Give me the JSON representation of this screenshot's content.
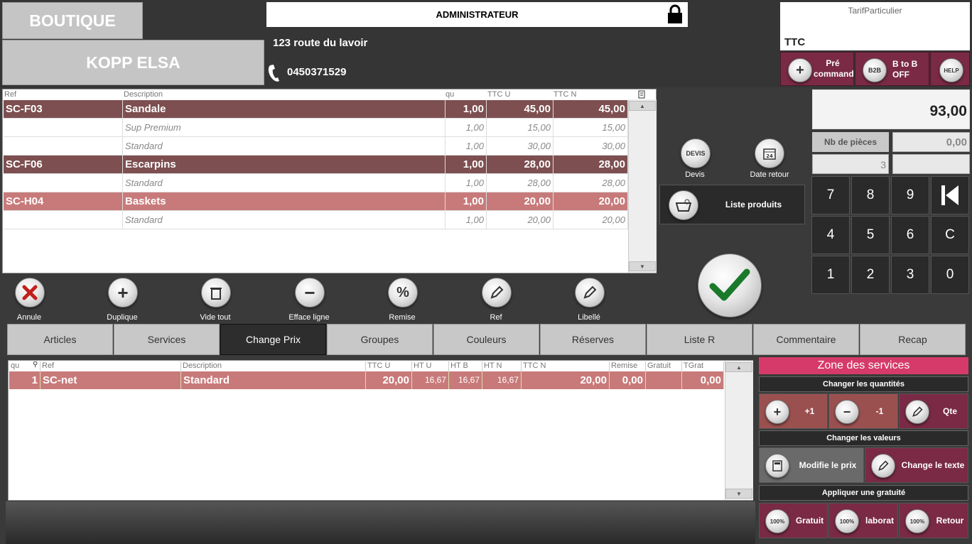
{
  "header": {
    "boutique_label": "BOUTIQUE",
    "client_name": "KOPP ELSA",
    "user_label": "ADMINISTRATEUR",
    "address": "123 route du lavoir",
    "phone": "0450371529",
    "tarif_label": "TarifParticulier",
    "tax_mode": "TTC",
    "precommande_label": "Pré commande",
    "btob_badge": "B2B",
    "btob_label": "B to B OFF",
    "help_badge": "HELP"
  },
  "cart": {
    "columns": [
      "Ref",
      "Description",
      "qu",
      "TTC U",
      "TTC N"
    ],
    "rows": [
      {
        "kind": "main",
        "ref": "SC-F03",
        "desc": "Sandale",
        "qty": "1,00",
        "ttcu": "45,00",
        "ttcn": "45,00",
        "color": "#7d4f50"
      },
      {
        "kind": "sub",
        "ref": "",
        "desc": "Sup Premium",
        "qty": "1,00",
        "ttcu": "15,00",
        "ttcn": "15,00"
      },
      {
        "kind": "sub",
        "ref": "",
        "desc": "Standard",
        "qty": "1,00",
        "ttcu": "30,00",
        "ttcn": "30,00"
      },
      {
        "kind": "main",
        "ref": "SC-F06",
        "desc": "Escarpins",
        "qty": "1,00",
        "ttcu": "28,00",
        "ttcn": "28,00",
        "color": "#7d4f50"
      },
      {
        "kind": "sub",
        "ref": "",
        "desc": "Standard",
        "qty": "1,00",
        "ttcu": "28,00",
        "ttcn": "28,00"
      },
      {
        "kind": "main",
        "ref": "SC-H04",
        "desc": "Baskets",
        "qty": "1,00",
        "ttcu": "20,00",
        "ttcn": "20,00",
        "color": "#c87a7a"
      },
      {
        "kind": "sub",
        "ref": "",
        "desc": "Standard",
        "qty": "1,00",
        "ttcu": "20,00",
        "ttcn": "20,00"
      }
    ]
  },
  "toolbar": {
    "annule": "Annule",
    "duplique": "Duplique",
    "vide_tout": "Vide tout",
    "efface_ligne": "Efface ligne",
    "remise": "Remise",
    "ref": "Ref",
    "libelle": "Libellé"
  },
  "actions": {
    "devis_badge": "DEVIS",
    "devis": "Devis",
    "date_retour": "Date retour",
    "calendar_day": "24",
    "liste_produits": "Liste produits"
  },
  "totals": {
    "total": "93,00",
    "nb_pieces_label": "Nb de pièces",
    "nb_pieces_value": "0,00",
    "qty_input": "3"
  },
  "keypad": {
    "keys": [
      "7",
      "8",
      "9",
      "",
      "4",
      "5",
      "6",
      "C",
      "1",
      "2",
      "3",
      "0"
    ]
  },
  "tabs": [
    "Articles",
    "Services",
    "Change Prix",
    "Groupes",
    "Couleurs",
    "Réserves",
    "Liste R",
    "Commentaire",
    "Recap"
  ],
  "active_tab": "Change Prix",
  "services_grid": {
    "columns": [
      "qu",
      "Ref",
      "Description",
      "TTC U",
      "HT U",
      "HT B",
      "HT N",
      "TTC N",
      "Remise",
      "Gratuit",
      "TGrat"
    ],
    "row": {
      "qu": "1",
      "ref": "SC-net",
      "desc": "Standard",
      "ttcu": "20,00",
      "htu": "16,67",
      "htb": "16,67",
      "htn": "16,67",
      "ttcn": "20,00",
      "remise": "0,00",
      "gratuit": "",
      "tgrat": "0,00"
    }
  },
  "zone": {
    "title": "Zone des services",
    "changer_quantites": "Changer les quantités",
    "plus_one": "+1",
    "minus_one": "-1",
    "qte": "Qte",
    "changer_valeurs": "Changer les valeurs",
    "modifie_prix": "Modifie le prix",
    "change_texte": "Change le texte",
    "appliquer_gratuite": "Appliquer une gratuité",
    "badge_100": "100%",
    "gratuit": "Gratuit",
    "laborat": "laborat",
    "retour": "Retour"
  }
}
